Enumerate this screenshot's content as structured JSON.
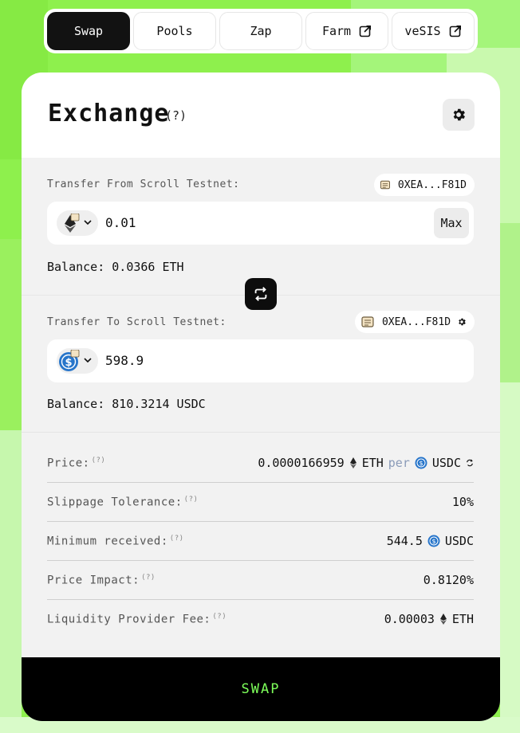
{
  "nav": {
    "tabs": [
      {
        "label": "Swap",
        "active": true
      },
      {
        "label": "Pools"
      },
      {
        "label": "Zap"
      },
      {
        "label": "Farm",
        "icon": "external-link-icon"
      },
      {
        "label": "veSIS",
        "icon": "external-link-icon"
      }
    ]
  },
  "exchange": {
    "title": "Exchange",
    "title_help": "(?)",
    "settings_icon": "gear-icon"
  },
  "from": {
    "label": "Transfer From Scroll Testnet:",
    "address": "0XEA...F81D",
    "token_icon": "eth-icon",
    "amount": "0.01",
    "max_label": "Max",
    "balance": "Balance: 0.0366 ETH"
  },
  "to": {
    "label": "Transfer To Scroll Testnet:",
    "address": "0XEA...F81D",
    "token_icon": "usdc-icon",
    "amount": "598.9",
    "balance": "Balance: 810.3214 USDC"
  },
  "details": {
    "help": "(?)",
    "price_label": "Price:",
    "price_eth": "0.0000166959",
    "price_eth_sym": "ETH",
    "price_per": "per",
    "price_usdc_sym": "USDC",
    "slippage_label": "Slippage Tolerance:",
    "slippage_value": "10%",
    "min_label": "Minimum received:",
    "min_value": "544.5",
    "min_sym": "USDC",
    "impact_label": "Price Impact:",
    "impact_value": "0.8120%",
    "fee_label": "Liquidity Provider Fee:",
    "fee_value": "0.00003",
    "fee_sym": "ETH"
  },
  "swap_button": "SWAP",
  "colors": {
    "accent": "#7dff5a",
    "background": "#8ef04d",
    "usdc": "#2775ca"
  }
}
